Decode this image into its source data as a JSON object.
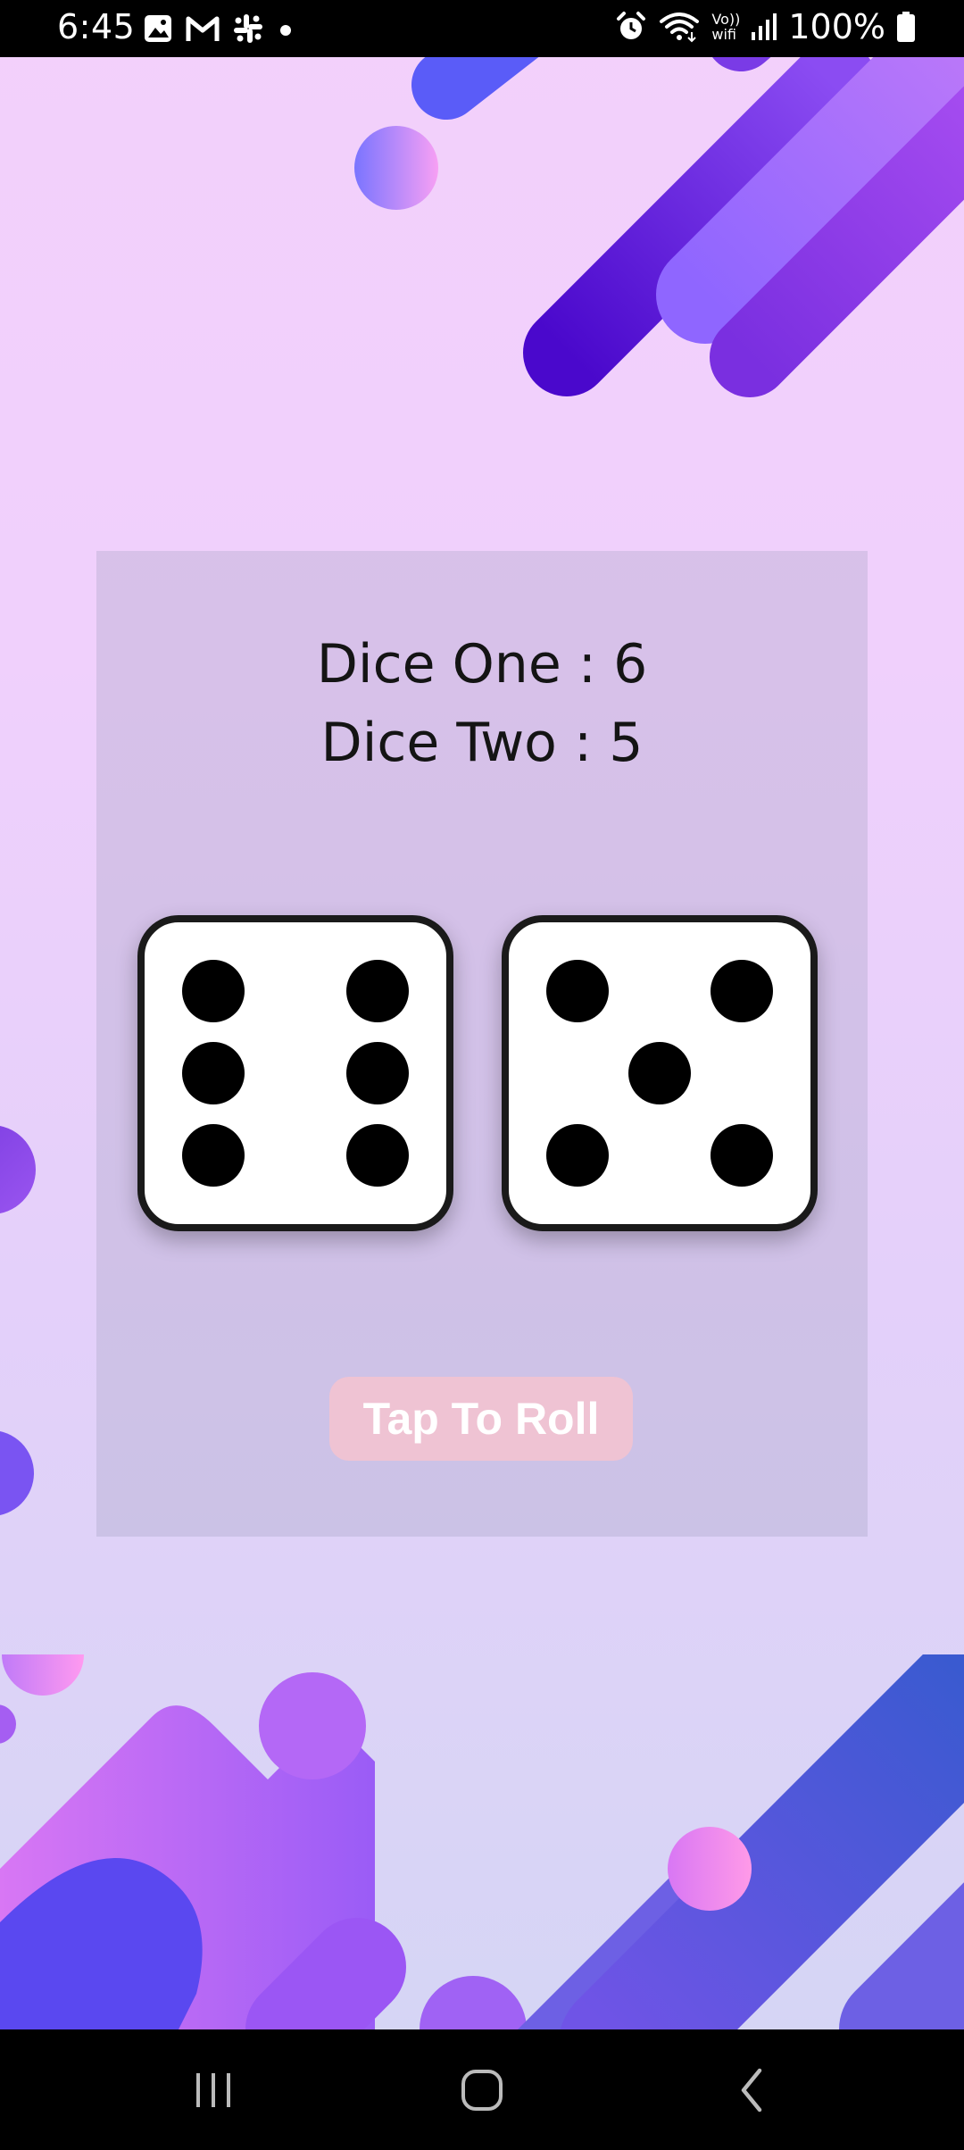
{
  "status_bar": {
    "time": "6:45",
    "battery_text": "100%",
    "left_icons": [
      "gallery-icon",
      "gmail-icon",
      "slack-icon",
      "dot-icon"
    ],
    "right_icons": [
      "alarm-icon",
      "wifi-icon",
      "vowifi-icon",
      "signal-icon",
      "battery-icon"
    ],
    "vowifi_text_top": "Vo))",
    "vowifi_text_bottom": "wifi"
  },
  "dice_panel": {
    "dice_one_label": "Dice One : 6",
    "dice_two_label": "Dice Two : 5",
    "dice_one_value": 6,
    "dice_two_value": 5
  },
  "roll_button": {
    "label": "Tap To Roll"
  },
  "nav_bar": {
    "icons": [
      "recents-icon",
      "home-icon",
      "back-icon"
    ]
  },
  "colors": {
    "background_top": "#f3d0fb",
    "background_bottom": "#d3d6f4",
    "button": "#efc3d3",
    "purple_dark": "#5a14d8",
    "purple_light": "#9b6cff",
    "blue": "#4c55ee",
    "pink": "#e07cf4"
  }
}
